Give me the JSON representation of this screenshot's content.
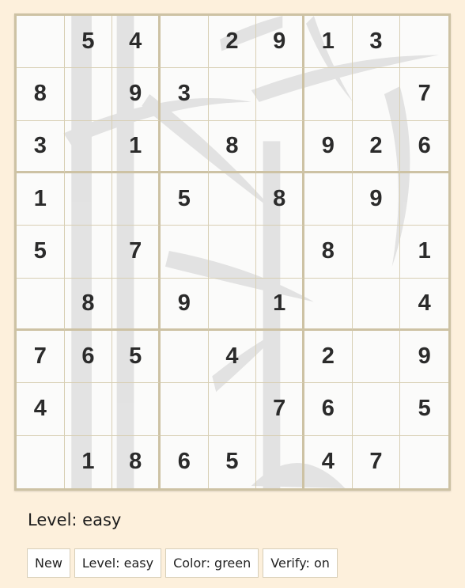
{
  "game": "Sudoku",
  "board": {
    "rows": [
      [
        "",
        "5",
        "4",
        "",
        "2",
        "9",
        "1",
        "3",
        ""
      ],
      [
        "8",
        "",
        "9",
        "3",
        "",
        "",
        "",
        "",
        "7"
      ],
      [
        "3",
        "",
        "1",
        "",
        "8",
        "",
        "9",
        "2",
        "6"
      ],
      [
        "1",
        "",
        "",
        "5",
        "",
        "8",
        "",
        "9",
        ""
      ],
      [
        "5",
        "",
        "7",
        "",
        "",
        "",
        "8",
        "",
        "1"
      ],
      [
        "",
        "8",
        "",
        "9",
        "",
        "1",
        "",
        "",
        "4"
      ],
      [
        "7",
        "6",
        "5",
        "",
        "4",
        "",
        "2",
        "",
        "9"
      ],
      [
        "4",
        "",
        "",
        "",
        "",
        "7",
        "6",
        "",
        "5"
      ],
      [
        "",
        "1",
        "8",
        "6",
        "5",
        "",
        "4",
        "7",
        ""
      ]
    ],
    "background": "bamboo-ink-painting"
  },
  "status": {
    "level_text": "Level: easy"
  },
  "buttons": [
    {
      "id": "new",
      "label": "New"
    },
    {
      "id": "level",
      "label": "Level: easy"
    },
    {
      "id": "color",
      "label": "Color: green"
    },
    {
      "id": "verify",
      "label": "Verify: on"
    }
  ],
  "colors": {
    "page_background": "#fdf0dc",
    "grid_border": "#cdc2a4",
    "digit": "#2b2b2b"
  }
}
